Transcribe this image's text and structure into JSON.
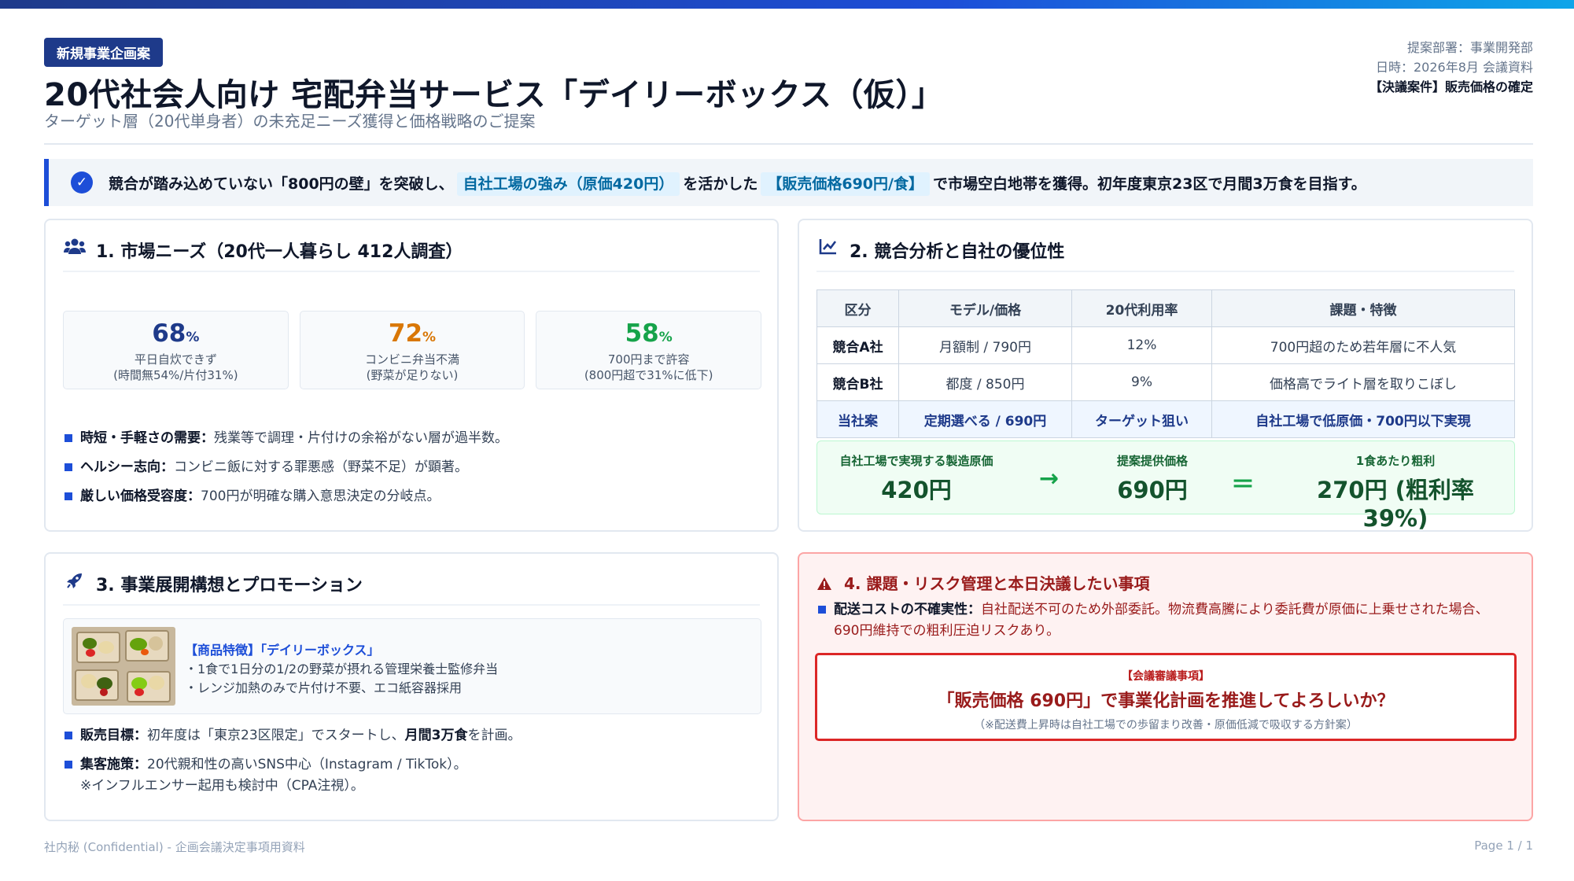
{
  "header": {
    "badge": "新規事業企画案",
    "title": "20代社会人向け 宅配弁当サービス「デイリーボックス（仮）」",
    "subtitle": "ターゲット層（20代単身者）の未充足ニーズ獲得と価格戦略のご提案",
    "department": "提案部署：事業開発部",
    "date": "日時：2026年8月 会議資料",
    "decision": "【決議案件】販売価格の確定"
  },
  "summary": {
    "part1": "競合が踏み込めていない「800円の壁」を突破し、",
    "highlight1": "自社工場の強み（原価420円）",
    "part2": "を活かした",
    "highlight2": "【販売価格690円/食】",
    "part3": "で市場空白地帯を獲得。初年度東京23区で月間3万食を目指す。"
  },
  "section1": {
    "title": "1. 市場ニーズ（20代一人暮らし 412人調査）",
    "stats": [
      {
        "value": "68",
        "unit": "%",
        "label": "平日自炊できず",
        "note": "(時間無54%/片付31%)",
        "color": "#1e3a8a"
      },
      {
        "value": "72",
        "unit": "%",
        "label": "コンビニ弁当不満",
        "note": "(野菜が足りない)",
        "color": "#d97706"
      },
      {
        "value": "58",
        "unit": "%",
        "label": "700円まで許容",
        "note": "(800円超で31%に低下)",
        "color": "#16a34a"
      }
    ],
    "bullets": [
      {
        "head": "時短・手軽さの需要：",
        "text": "残業等で調理・片付けの余裕がない層が過半数。"
      },
      {
        "head": "ヘルシー志向：",
        "text": "コンビニ飯に対する罪悪感（野菜不足）が顕著。"
      },
      {
        "head": "厳しい価格受容度：",
        "text": "700円が明確な購入意思決定の分岐点。"
      }
    ]
  },
  "section2": {
    "title": "2. 競合分析と自社の優位性",
    "headers": [
      "区分",
      "モデル/価格",
      "20代利用率",
      "課題・特徴"
    ],
    "rows": [
      [
        "競合A社",
        "月額制 / 790円",
        "12%",
        "700円超のため若年層に不人気"
      ],
      [
        "競合B社",
        "都度 / 850円",
        "9%",
        "価格高でライト層を取りこぼし"
      ],
      [
        "当社案",
        "定期選べる / 690円",
        "ターゲット狙い",
        "自社工場で低原価・700円以下実現"
      ]
    ],
    "cost_label": "自社工場で実現する製造原価",
    "cost_value": "420円",
    "arrow": "→",
    "price_label": "提案提供価格",
    "price_value": "690円",
    "equals": "＝",
    "profit_label": "1食あたり粗利",
    "profit_value": "270円 (粗利率39%)"
  },
  "section3": {
    "title": "3. 事業展開構想とプロモーション",
    "feature_title": "【商品特徴】「デイリーボックス」",
    "feature_lines": [
      "・1食で1日分の1/2の野菜が摂れる管理栄養士監修弁当",
      "・レンジ加熱のみで片付け不要、エコ紙容器採用"
    ],
    "target_head": "販売目標：",
    "target_text1": "初年度は「東京23区限定」でスタートし、",
    "target_strong": "月間3万食",
    "target_text2": "を計画。",
    "promo_head": "集客施策：",
    "promo_text": "20代親和性の高いSNS中心（Instagram / TikTok）。",
    "promo_note": "※インフルエンサー起用も検討中（CPA注視）。"
  },
  "section4": {
    "title": "4. 課題・リスク管理と本日決議したい事項",
    "risk_head": "配送コストの不確実性：",
    "risk_text": "自社配送不可のため外部委託。物流費高騰により委託費が原価に上乗せされた場合、690円維持での粗利圧迫リスクあり。",
    "ask_label": "【会議審議事項】",
    "ask_question": "「販売価格 690円」で事業化計画を推進してよろしいか？",
    "ask_note": "（※配送費上昇時は自社工場での歩留まり改善・原価低減で吸収する方針案）"
  },
  "footer": {
    "left": "社内秘 (Confidential) - 企画会議決定事項用資料",
    "right": "Page 1 / 1"
  }
}
